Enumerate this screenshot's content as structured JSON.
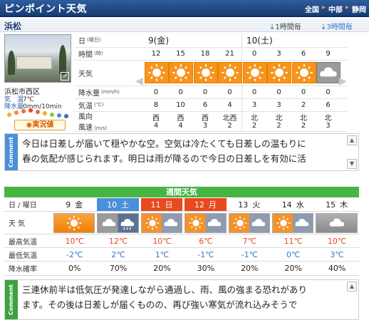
{
  "header": {
    "title": "ピンポイント天気",
    "crumbs": [
      "全国",
      "中部",
      "静岡"
    ]
  },
  "location": {
    "name": "浜松",
    "mode_hourly1": "1時間毎",
    "mode_hourly3": "3時間毎"
  },
  "station": {
    "name": "浜松市西区",
    "temp_label": "気　温",
    "temp": "7℃",
    "precip_label": "降水量",
    "precip": "0mm/10min",
    "live_button": "実況値"
  },
  "hourly": {
    "labels": {
      "day": "日",
      "day_sub": "(曜日)",
      "time": "時間",
      "time_sub": "(時)",
      "weather": "天気",
      "precip": "降水量",
      "precip_sub": "(mm/h)",
      "temp": "気温",
      "temp_sub": "(℃)",
      "wind": "風向",
      "wind2": "風速",
      "wind_sub": "(m/s)"
    },
    "days": [
      "9(金)",
      "10(土)"
    ],
    "hours": [
      "12",
      "15",
      "18",
      "21",
      "0",
      "3",
      "6",
      "9"
    ],
    "weather": [
      "sun",
      "sun",
      "sun",
      "sun",
      "sun",
      "sun",
      "sun",
      "cloud"
    ],
    "precip": [
      "0",
      "0",
      "0",
      "0",
      "0",
      "0",
      "0",
      "0"
    ],
    "temp": [
      "8",
      "10",
      "6",
      "4",
      "3",
      "3",
      "2",
      "6"
    ],
    "wind_dir": [
      "西",
      "西",
      "西",
      "北西",
      "北",
      "北",
      "北",
      "北"
    ],
    "wind_speed": [
      "4",
      "4",
      "3",
      "2",
      "2",
      "2",
      "2",
      "3"
    ]
  },
  "comment1": {
    "tag": "Comment",
    "lines": [
      "今日は日差しが届いて穏やかな空。空気は冷たくても日差しの温もりに",
      "春の気配が感じられます。明日は雨が降るので今日の日差しを有効に活"
    ]
  },
  "weekly": {
    "title": "週間天気",
    "labels": {
      "day": "日 / 曜日",
      "weather": "天 気",
      "high": "最高気温",
      "low": "最低気温",
      "rain": "降水確率"
    },
    "days": [
      {
        "d": "9",
        "w": "金",
        "type": "norm",
        "icon": "sun",
        "hi": "10℃",
        "lo": "-2℃",
        "rain": "0%"
      },
      {
        "d": "10",
        "w": "土",
        "type": "sat",
        "icon": "cloud-rain",
        "hi": "12℃",
        "lo": "2℃",
        "rain": "70%"
      },
      {
        "d": "11",
        "w": "日",
        "type": "hol",
        "icon": "sun-cloud",
        "hi": "10℃",
        "lo": "1℃",
        "rain": "20%"
      },
      {
        "d": "12",
        "w": "月",
        "type": "hol",
        "icon": "sun-cloud",
        "hi": "6℃",
        "lo": "-1℃",
        "rain": "30%"
      },
      {
        "d": "13",
        "w": "火",
        "type": "norm",
        "icon": "sun-cloud",
        "hi": "7℃",
        "lo": "-1℃",
        "rain": "20%"
      },
      {
        "d": "14",
        "w": "水",
        "type": "norm",
        "icon": "sun-cloud",
        "hi": "11℃",
        "lo": "0℃",
        "rain": "20%"
      },
      {
        "d": "15",
        "w": "木",
        "type": "norm",
        "icon": "cloud",
        "hi": "10℃",
        "lo": "3℃",
        "rain": "40%"
      }
    ]
  },
  "comment2": {
    "tag": "Comment",
    "lines": [
      "三連休前半は低気圧が発達しながら通過し、雨、風の強まる恐れがあり",
      "ます。その後は日差しが届くものの、再び強い寒気が流れ込みそうで"
    ]
  },
  "colors": {
    "header": "#173d76",
    "orange": "#f7941d",
    "blue": "#4a8fd9",
    "green": "#47b543",
    "red": "#e8491d"
  }
}
